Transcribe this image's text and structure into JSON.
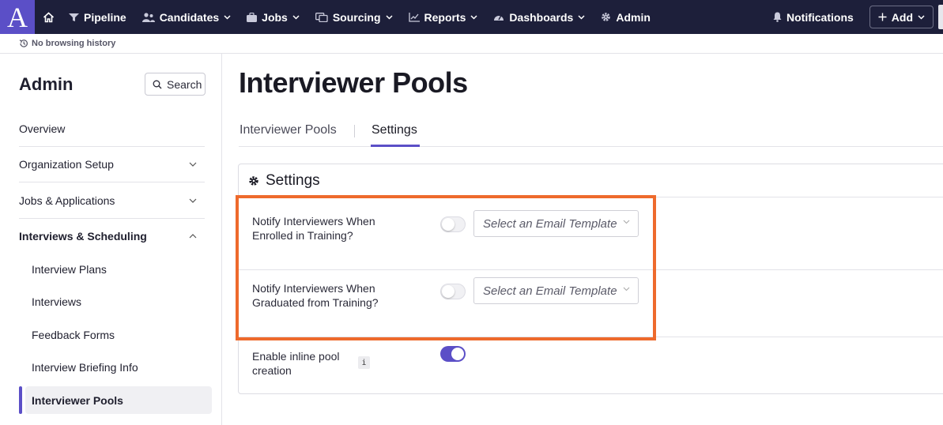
{
  "topbar": {
    "logo_text": "A",
    "nav": [
      {
        "label": "Pipeline",
        "icon": "funnel-icon"
      },
      {
        "label": "Candidates",
        "icon": "people-icon"
      },
      {
        "label": "Jobs",
        "icon": "briefcase-icon"
      },
      {
        "label": "Sourcing",
        "icon": "sourcing-icon"
      },
      {
        "label": "Reports",
        "icon": "chart-icon"
      },
      {
        "label": "Dashboards",
        "icon": "gauge-icon"
      },
      {
        "label": "Admin",
        "icon": "gear-icon"
      }
    ],
    "notifications_label": "Notifications",
    "add_label": "Add"
  },
  "history": {
    "text": "No browsing history"
  },
  "sidebar": {
    "title": "Admin",
    "search_label": "Search",
    "items": [
      {
        "label": "Overview"
      },
      {
        "label": "Organization Setup"
      },
      {
        "label": "Jobs & Applications"
      },
      {
        "label": "Interviews & Scheduling"
      }
    ],
    "subitems": [
      {
        "label": "Interview Plans"
      },
      {
        "label": "Interviews"
      },
      {
        "label": "Feedback Forms"
      },
      {
        "label": "Interview Briefing Info"
      },
      {
        "label": "Interviewer Pools"
      }
    ]
  },
  "main": {
    "title": "Interviewer Pools",
    "tabs": [
      {
        "label": "Interviewer Pools"
      },
      {
        "label": "Settings"
      }
    ],
    "card": {
      "header": "Settings",
      "rows": [
        {
          "label": "Notify Interviewers When Enrolled in Training?",
          "toggle": false,
          "select_placeholder": "Select an Email Template"
        },
        {
          "label": "Notify Interviewers When Graduated from Training?",
          "toggle": false,
          "select_placeholder": "Select an Email Template"
        },
        {
          "label": "Enable inline pool creation",
          "toggle": true,
          "info": "i"
        }
      ]
    }
  },
  "colors": {
    "accent": "#5b4fc7",
    "nav_bg": "#1d1f3a",
    "highlight": "#ee6a2c"
  }
}
